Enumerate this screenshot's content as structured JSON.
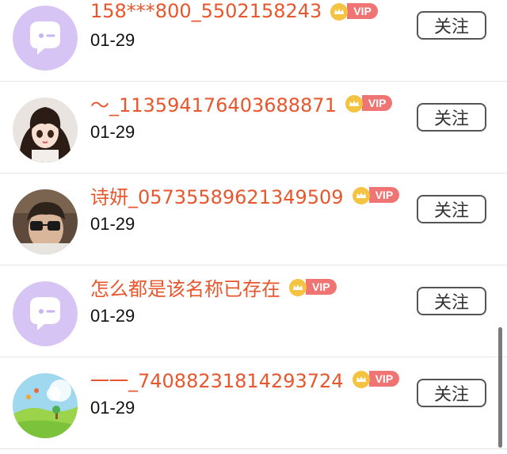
{
  "follow_label": "关注",
  "vip_label": "VIP",
  "users": [
    {
      "name": "158***800_5502158243",
      "date": "01-29",
      "avatar": "default-avatar-icon"
    },
    {
      "name": "～_113594176403688871",
      "date": "01-29",
      "avatar": "girl-cartoon-photo"
    },
    {
      "name": "诗妍_05735589621349509",
      "date": "01-29",
      "avatar": "child-glasses-photo"
    },
    {
      "name": "怎么都是该名称已存在",
      "date": "01-29",
      "avatar": "default-avatar-icon"
    },
    {
      "name": "一一_74088231814293724",
      "date": "01-29",
      "avatar": "landscape-cartoon-photo"
    }
  ],
  "colors": {
    "name": "#e8562d",
    "vip_badge": "#ef7474",
    "default_avatar_bg": "#d6c4f5"
  }
}
